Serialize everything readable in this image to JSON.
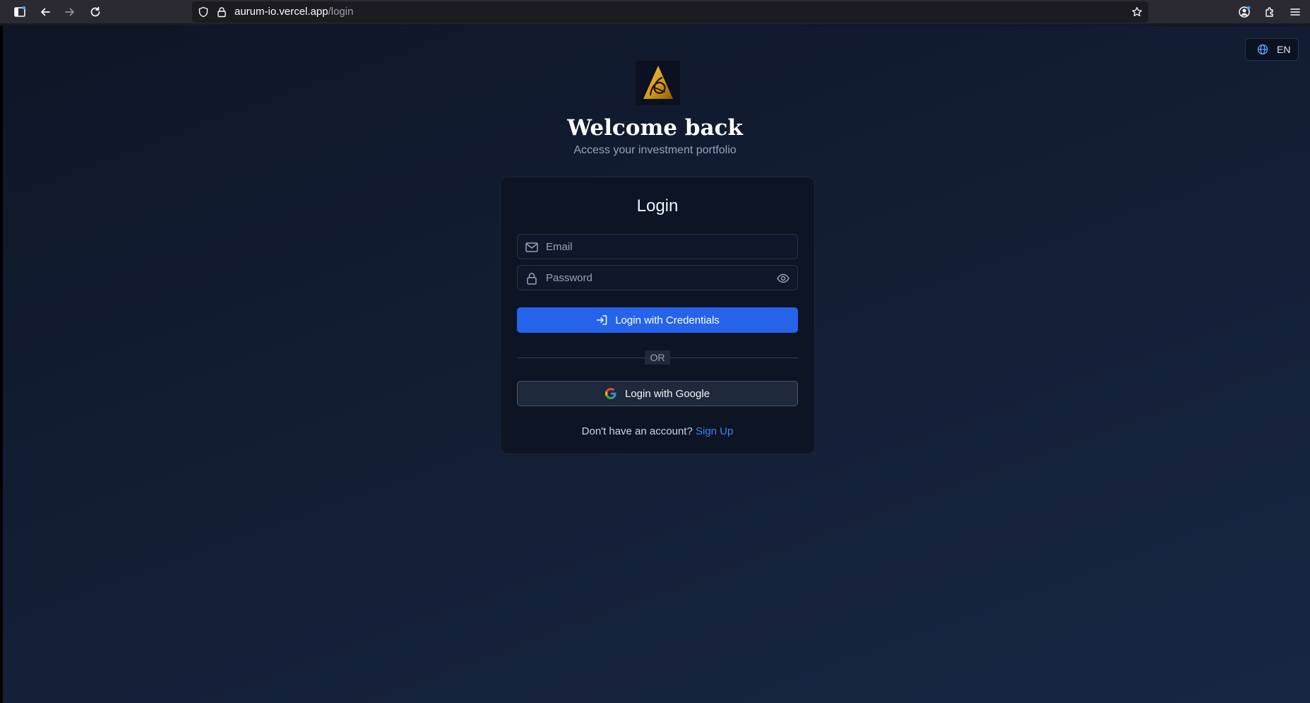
{
  "browser": {
    "url_host": "aurum-io.vercel.app",
    "url_path": "/login"
  },
  "language": {
    "label": "EN"
  },
  "header": {
    "title": "Welcome back",
    "subtitle": "Access your investment portfolio"
  },
  "login_card": {
    "title": "Login",
    "email_placeholder": "Email",
    "password_placeholder": "Password",
    "credentials_button": "Login with Credentials",
    "divider": "OR",
    "google_button": "Login with Google",
    "signup_prompt": "Don't have an account?",
    "signup_link": "Sign Up"
  },
  "colors": {
    "accent": "#2563eb",
    "link": "#3b82f6",
    "background": "#0f172a",
    "logo_gold": "#d4a017"
  },
  "icons": {
    "sidebar": "sidebar-icon",
    "back": "arrow-left-icon",
    "forward": "arrow-right-icon",
    "reload": "reload-icon",
    "shield": "shield-icon",
    "lock": "lock-icon",
    "bookmark": "star-icon",
    "account": "account-icon",
    "extensions": "puzzle-icon",
    "menu": "hamburger-icon",
    "globe": "globe-icon",
    "mail": "mail-icon",
    "password_lock": "lock-icon",
    "eye": "eye-icon",
    "login": "login-icon",
    "google": "google-icon"
  }
}
